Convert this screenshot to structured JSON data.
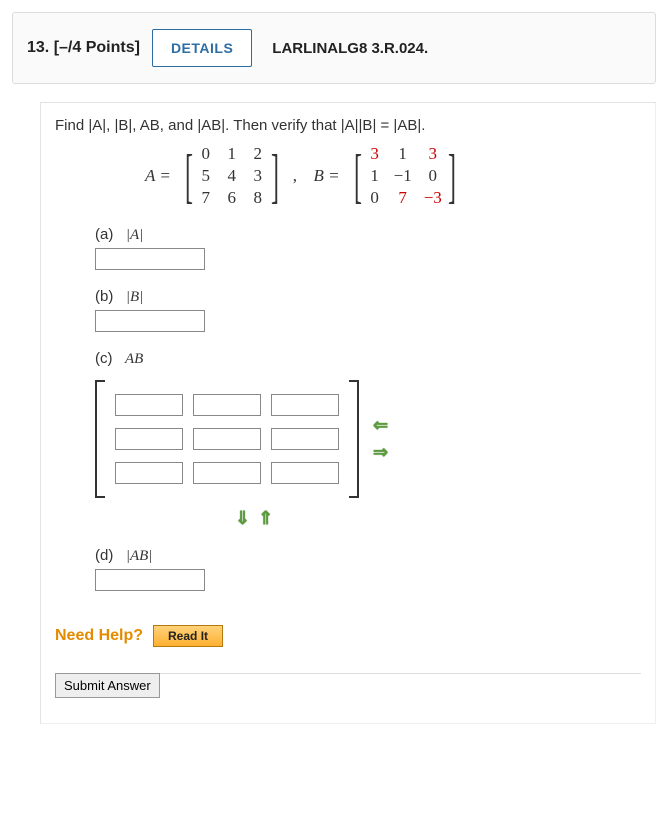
{
  "header": {
    "number": "13.",
    "points": "[–/4 Points]",
    "details_label": "DETAILS",
    "reference": "LARLINALG8 3.R.024."
  },
  "prompt": "Find  |A|,  |B|,  AB,  and  |AB|.  Then verify that  |A||B| = |AB|.",
  "matrixA": {
    "label": "A =",
    "rows": [
      [
        "0",
        "1",
        "2"
      ],
      [
        "5",
        "4",
        "3"
      ],
      [
        "7",
        "6",
        "8"
      ]
    ]
  },
  "matrixB": {
    "label": "B =",
    "rows": [
      [
        "3",
        "1",
        "3"
      ],
      [
        "1",
        "−1",
        "0"
      ],
      [
        "0",
        "7",
        "−3"
      ]
    ],
    "red_cells": [
      [
        0,
        0
      ],
      [
        0,
        2
      ],
      [
        2,
        1
      ],
      [
        2,
        2
      ]
    ]
  },
  "parts": {
    "a": {
      "label": "(a)",
      "var": "|A|"
    },
    "b": {
      "label": "(b)",
      "var": "|B|"
    },
    "c": {
      "label": "(c)",
      "var": "AB"
    },
    "d": {
      "label": "(d)",
      "var": "|AB|"
    }
  },
  "need_help": {
    "label": "Need Help?",
    "readit": "Read It"
  },
  "submit_label": "Submit Answer",
  "arrows": {
    "left": "⇐",
    "right": "⇒",
    "down": "⇓",
    "up": "⇑"
  }
}
